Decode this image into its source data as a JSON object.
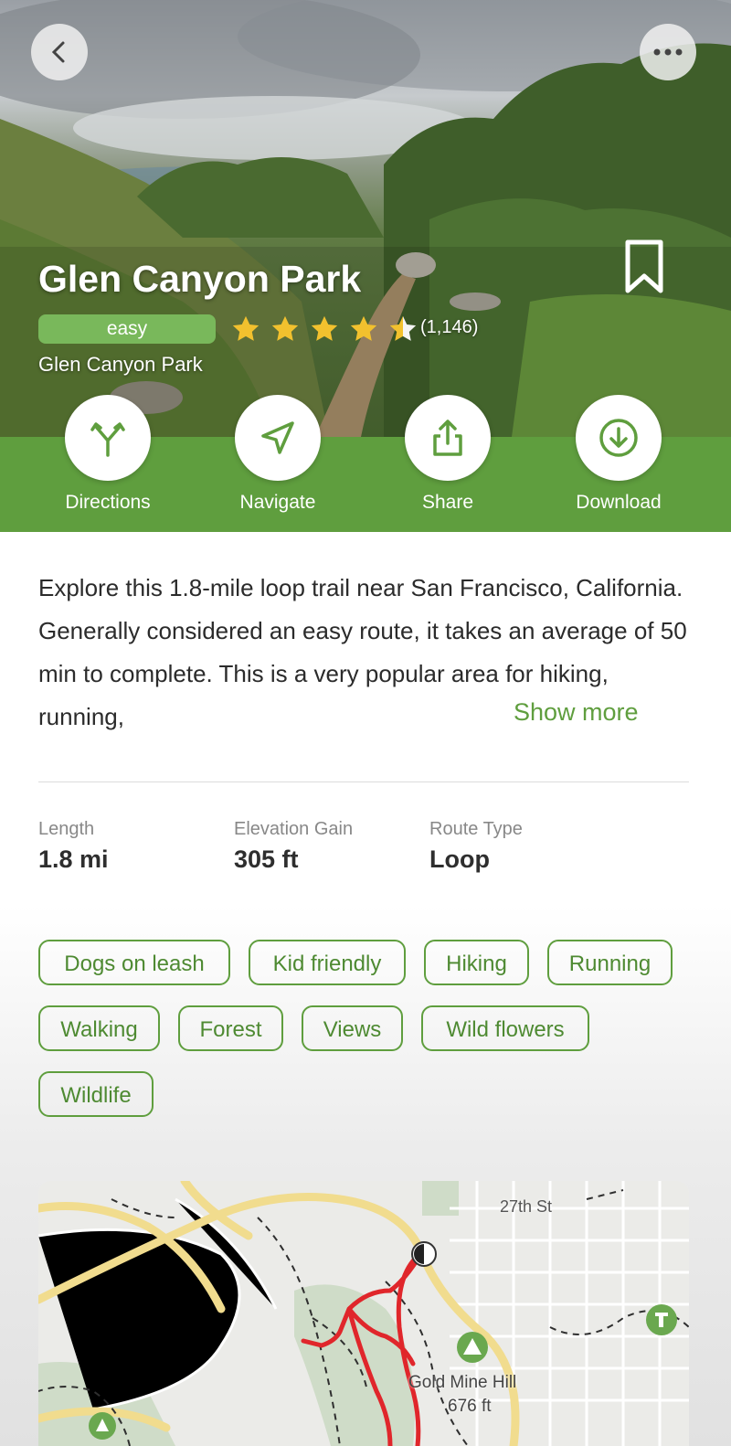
{
  "hero": {
    "title": "Glen Canyon Park",
    "difficulty": "easy",
    "rating": 4.5,
    "review_count": "(1,146)",
    "location": "Glen Canyon Park",
    "back_icon": "chevron-left-icon",
    "more_icon": "more-horizontal-icon",
    "bookmark_icon": "bookmark-icon"
  },
  "actions": [
    {
      "label": "Directions",
      "icon": "fork-directions-icon"
    },
    {
      "label": "Navigate",
      "icon": "navigate-arrow-icon"
    },
    {
      "label": "Share",
      "icon": "share-icon"
    },
    {
      "label": "Download",
      "icon": "download-icon"
    }
  ],
  "description": {
    "text": "Explore this 1.8-mile loop trail near San Francisco, California. Generally considered an easy route, it takes an average of 50 min to complete. This is a very popular area for hiking, running,",
    "show_more": "Show more"
  },
  "stats": [
    {
      "label": "Length",
      "value": "1.8 mi"
    },
    {
      "label": "Elevation Gain",
      "value": "305 ft"
    },
    {
      "label": "Route Type",
      "value": "Loop"
    }
  ],
  "tags": [
    "Dogs on leash",
    "Kid friendly",
    "Hiking",
    "Running",
    "Walking",
    "Forest",
    "Views",
    "Wild flowers",
    "Wildlife"
  ],
  "map": {
    "street_label": "27th St",
    "peak_name": "Gold Mine Hill",
    "peak_elevation": "676 ft"
  },
  "colors": {
    "brand_green": "#5f9e3e",
    "badge_green": "#79b85b",
    "star_yellow": "#f2c12e",
    "trail_red": "#e0262b"
  }
}
